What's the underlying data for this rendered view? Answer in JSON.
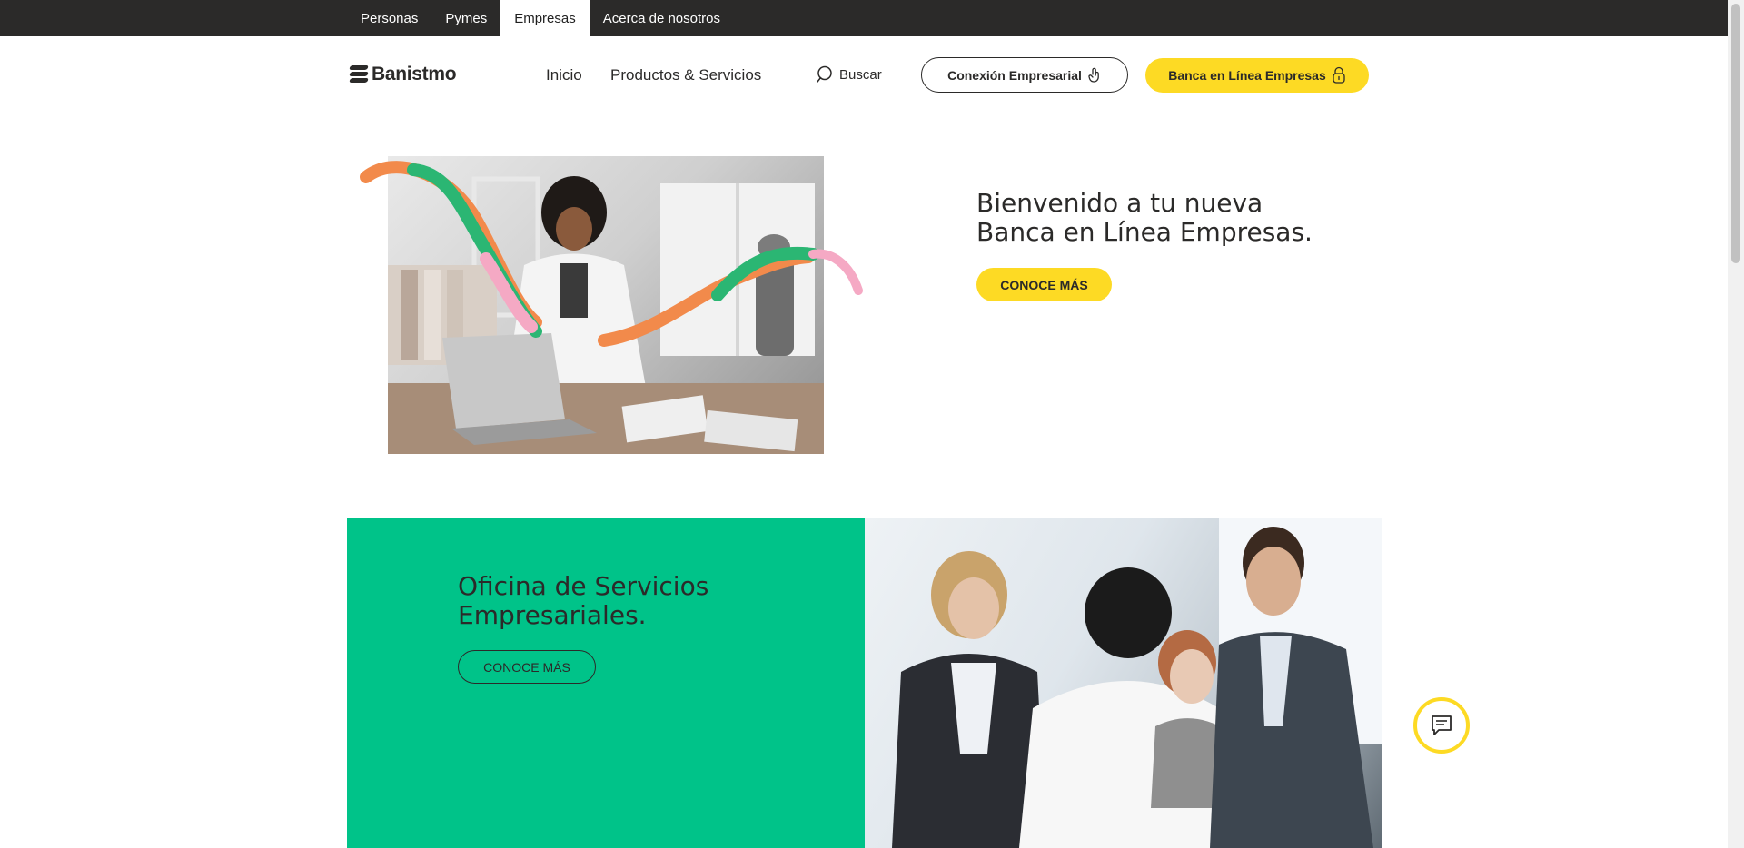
{
  "segments": [
    {
      "label": "Personas"
    },
    {
      "label": "Pymes"
    },
    {
      "label": "Empresas",
      "active": true
    },
    {
      "label": "Acerca de nosotros"
    }
  ],
  "header": {
    "logo_text": "Banistmo",
    "nav": [
      {
        "label": "Inicio"
      },
      {
        "label": "Productos & Servicios"
      }
    ],
    "search_label": "Buscar",
    "btn_connect": "Conexión Empresarial",
    "btn_banking": "Banca en Línea Empresas"
  },
  "hero": {
    "title_line1": "Bienvenido a tu nueva",
    "title_line2": "Banca en Línea Empresas.",
    "cta": "CONOCE MÁS"
  },
  "office": {
    "title_line1": "Oficina de Servicios",
    "title_line2": "Empresariales.",
    "cta": "CONOCE MÁS"
  },
  "colors": {
    "brand_yellow": "#fdda24",
    "brand_green": "#00c389",
    "topbar": "#2b2a29",
    "squiggle_orange": "#f28a4b",
    "squiggle_green": "#2bb673",
    "squiggle_pink": "#f5a9c4"
  },
  "icons": {
    "search": "search-icon",
    "connect": "touch-icon",
    "banking": "lock-icon",
    "chat": "chat-icon"
  }
}
